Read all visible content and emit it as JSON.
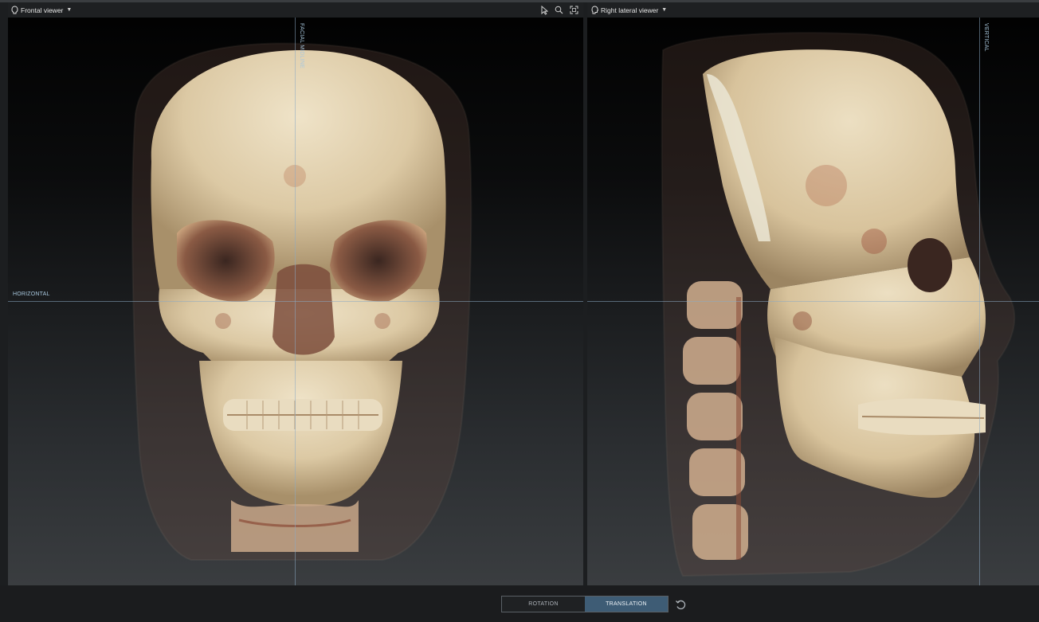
{
  "viewers": {
    "frontal": {
      "title": "Frontal viewer",
      "vertical_label": "FACIAL MIDLINE",
      "horizontal_label": "HORIZONTAL"
    },
    "lateral": {
      "title": "Right lateral viewer",
      "vertical_label": "VERTICAL"
    }
  },
  "toolbar": {
    "tools": [
      "cursor-icon",
      "zoom-icon",
      "fit-view-icon"
    ]
  },
  "footer": {
    "rotation_label": "ROTATION",
    "translation_label": "TRANSLATION",
    "active_mode": "TRANSLATION"
  },
  "colors": {
    "accent": "#3e5c75",
    "crosshair": "#8caac3",
    "bone": "#e0cfae",
    "soft_tissue": "#7a4a3c"
  }
}
